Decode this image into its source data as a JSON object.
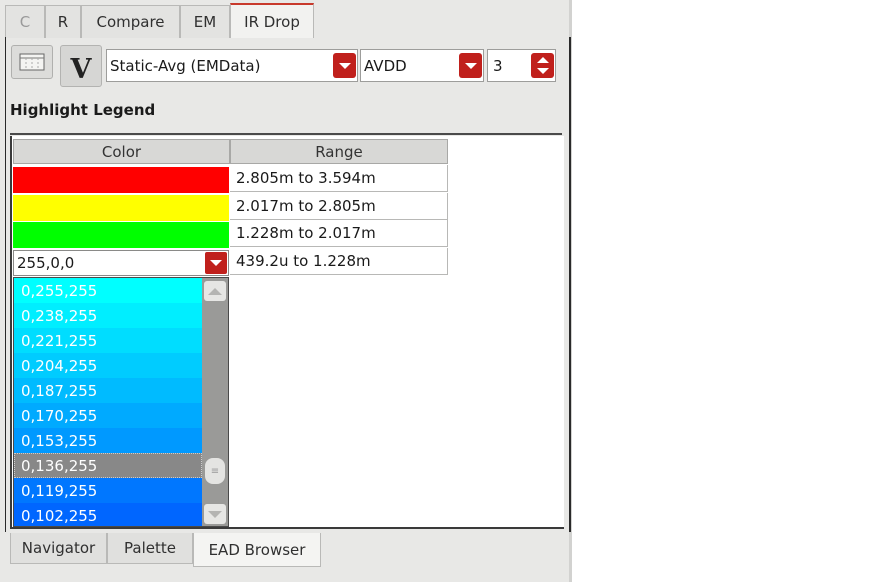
{
  "top_tabs": [
    {
      "label": "C",
      "active": false,
      "dim": true
    },
    {
      "label": "R",
      "active": false,
      "dim": false
    },
    {
      "label": "Compare",
      "active": false,
      "dim": false
    },
    {
      "label": "EM",
      "active": false,
      "dim": false
    },
    {
      "label": "IR Drop",
      "active": true,
      "dim": false
    }
  ],
  "toolbar": {
    "view_icon": "grid-settings-icon",
    "v_button_label": "V",
    "mode_select": {
      "value": "Static-Avg (EMData)"
    },
    "net_select": {
      "value": "AVDD"
    },
    "levels_spin": {
      "value": "3"
    }
  },
  "legend": {
    "title": "Highlight Legend",
    "columns": [
      "Color",
      "Range"
    ],
    "rows": [
      {
        "color": "#ff0000",
        "range": "2.805m to 3.594m"
      },
      {
        "color": "#ffff00",
        "range": "2.017m to 2.805m"
      },
      {
        "color": "#00ff00",
        "range": "1.228m to 2.017m"
      },
      {
        "color": "editing",
        "range": "439.2u to 1.228m"
      }
    ],
    "color_editor_value": "255,0,0"
  },
  "dropdown": {
    "options": [
      {
        "label": "0,255,255",
        "color": "#00ffff"
      },
      {
        "label": "0,238,255",
        "color": "#00eeff"
      },
      {
        "label": "0,221,255",
        "color": "#00ddff"
      },
      {
        "label": "0,204,255",
        "color": "#00ccff"
      },
      {
        "label": "0,187,255",
        "color": "#00bbff"
      },
      {
        "label": "0,170,255",
        "color": "#00aaff"
      },
      {
        "label": "0,153,255",
        "color": "#0099ff"
      },
      {
        "label": "0,136,255",
        "color": "#888888",
        "highlighted": true
      },
      {
        "label": "0,119,255",
        "color": "#0077ff"
      },
      {
        "label": "0,102,255",
        "color": "#0066ff"
      }
    ]
  },
  "bottom_tabs": [
    {
      "label": "Navigator",
      "active": false
    },
    {
      "label": "Palette",
      "active": false
    },
    {
      "label": "EAD Browser",
      "active": true
    }
  ]
}
